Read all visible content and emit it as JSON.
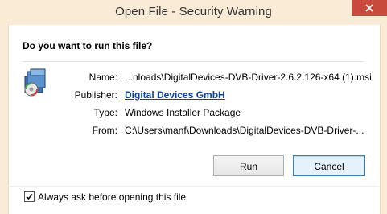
{
  "window": {
    "title": "Open File - Security Warning"
  },
  "dialog": {
    "question": "Do you want to run this file?",
    "fields": [
      {
        "label": "Name:",
        "value": "...nloads\\DigitalDevices-DVB-Driver-2.6.2.126-x64 (1).msi"
      },
      {
        "label": "Publisher:",
        "value": "Digital Devices GmbH"
      },
      {
        "label": "Type:",
        "value": "Windows Installer Package"
      },
      {
        "label": "From:",
        "value": "C:\\Users\\manf\\Downloads\\DigitalDevices-DVB-Driver-..."
      }
    ],
    "buttons": {
      "run": "Run",
      "cancel": "Cancel"
    },
    "always_ask": {
      "label": "Always ask before opening this file",
      "checked": true
    }
  },
  "colors": {
    "frame": "#f9ebd5",
    "close": "#c74a3c",
    "link": "#0b45a3"
  },
  "icons": [
    "close-icon",
    "installer-package-icon",
    "checkmark-icon"
  ]
}
